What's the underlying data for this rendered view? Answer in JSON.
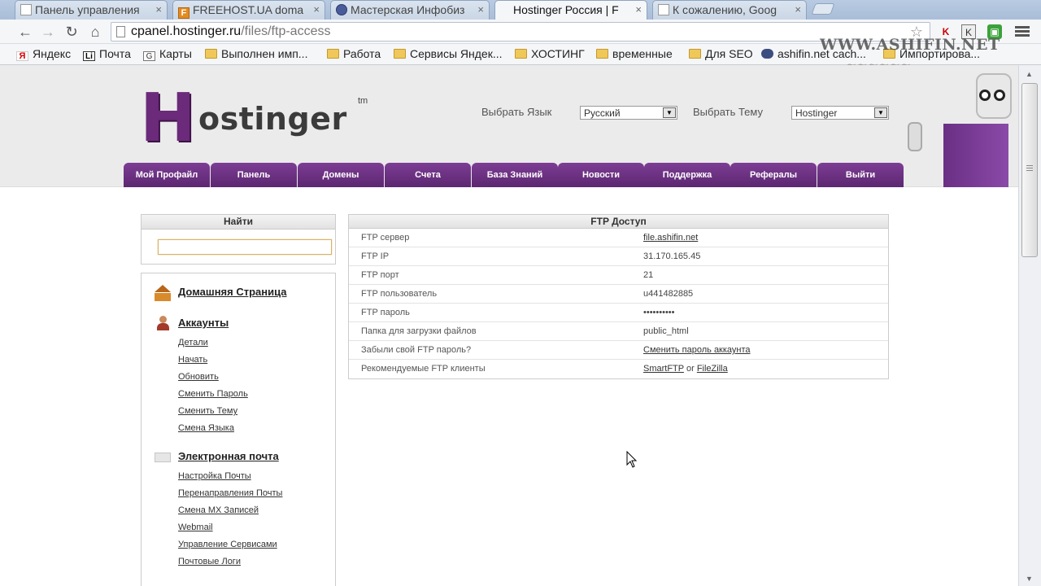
{
  "browser": {
    "tabs": [
      {
        "label": "Панель управления",
        "icon": "page-icon",
        "active": false
      },
      {
        "label": "FREEHOST.UA doma",
        "icon": "freehost-icon",
        "active": false
      },
      {
        "label": "Мастерская Инфобиз",
        "icon": "person-icon",
        "active": false
      },
      {
        "label": "Hostinger Россия | F",
        "icon": "none",
        "active": true
      },
      {
        "label": "К сожалению, Goog",
        "icon": "page-icon",
        "active": false
      }
    ],
    "url_host": "cpanel.hostinger.ru",
    "url_path": "/files/ftp-access",
    "bookmarks": [
      {
        "label": "Яндекс",
        "icon": "yandex-icon"
      },
      {
        "label": "Почта",
        "icon": "li-icon"
      },
      {
        "label": "Карты",
        "icon": "g-icon"
      },
      {
        "label": "Выполнен имп...",
        "icon": "folder-icon"
      },
      {
        "label": "Работа",
        "icon": "folder-icon"
      },
      {
        "label": "Сервисы Яндек...",
        "icon": "folder-icon"
      },
      {
        "label": "ХОСТИНГ",
        "icon": "folder-icon"
      },
      {
        "label": "временные",
        "icon": "folder-icon"
      },
      {
        "label": "Для SEO",
        "icon": "folder-icon"
      },
      {
        "label": "ashifin.net cach...",
        "icon": "user-icon"
      },
      {
        "label": "Импортирова...",
        "icon": "folder-icon"
      }
    ]
  },
  "watermark": {
    "text": "WWW.ASHIFIN.NET"
  },
  "header": {
    "logo_text": "ostinger",
    "logo_letter": "H",
    "logo_tm": "tm",
    "language_label": "Выбрать Язык",
    "language_value": "Русский",
    "theme_label": "Выбрать Тему",
    "theme_value": "Hostinger"
  },
  "nav": [
    "Мой Профайл",
    "Панель",
    "Домены",
    "Счета",
    "База Знаний",
    "Новости",
    "Поддержка",
    "Рефералы",
    "Выйти"
  ],
  "search": {
    "title": "Найти",
    "value": ""
  },
  "sidemenu": {
    "home": "Домашняя Страница",
    "accounts": {
      "title": "Аккаунты",
      "links": [
        "Детали",
        "Начать",
        "Обновить",
        "Сменить Пароль",
        "Сменить Тему",
        "Смена Языка"
      ]
    },
    "email": {
      "title": "Электронная почта",
      "links": [
        "Настройка Почты",
        "Перенаправления Почты",
        "Смена MX Записей",
        "Webmail",
        "Управление Сервисами",
        "Почтовые Логи"
      ]
    }
  },
  "ftp": {
    "title": "FTP Доступ",
    "rows": [
      {
        "label": "FTP сервер",
        "value": "file.ashifin.net",
        "link": true
      },
      {
        "label": "FTP IP",
        "value": "31.170.165.45",
        "link": false
      },
      {
        "label": "FTP порт",
        "value": "21",
        "link": false
      },
      {
        "label": "FTP пользователь",
        "value": "u441482885",
        "link": false
      },
      {
        "label": "FTP пароль",
        "value": "••••••••••",
        "link": false
      },
      {
        "label": "Папка для загрузки файлов",
        "value": "public_html",
        "link": false
      },
      {
        "label": "Забыли свой FTP пароль?",
        "value": "Сменить пароль аккаунта",
        "link": true
      }
    ],
    "clients_label": "Рекомендуемые FTP клиенты",
    "client_a": "SmartFTP",
    "client_or": "or",
    "client_b": "FileZilla"
  }
}
